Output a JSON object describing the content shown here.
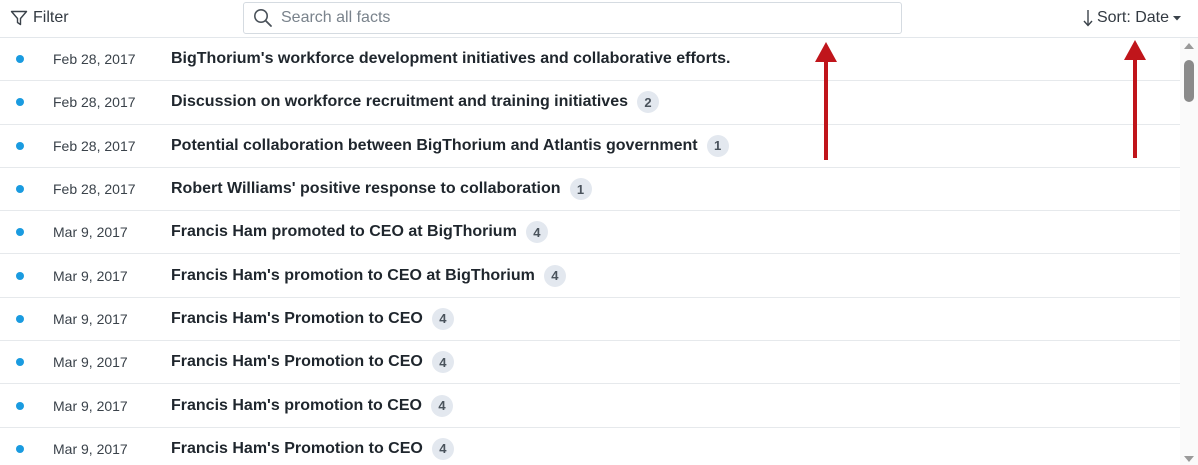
{
  "toolbar": {
    "filter_label": "Filter",
    "search_placeholder": "Search all facts",
    "search_value": "",
    "sort_label": "Sort: Date"
  },
  "icons": {
    "filter": "filter-icon",
    "search": "search-icon",
    "sort": "sort-arrow-down-icon",
    "sort_dropdown": "caret-down-icon"
  },
  "colors": {
    "dot": "#1a9be0",
    "count_badge_bg": "#e3e8ef",
    "annotation_arrow": "#c0151b"
  },
  "facts": [
    {
      "date": "Feb 28, 2017",
      "title": "BigThorium's workforce development initiatives and collaborative efforts.",
      "count": ""
    },
    {
      "date": "Feb 28, 2017",
      "title": "Discussion on workforce recruitment and training initiatives",
      "count": "2"
    },
    {
      "date": "Feb 28, 2017",
      "title": "Potential collaboration between BigThorium and Atlantis government",
      "count": "1"
    },
    {
      "date": "Feb 28, 2017",
      "title": "Robert Williams' positive response to collaboration",
      "count": "1"
    },
    {
      "date": "Mar 9, 2017",
      "title": "Francis Ham promoted to CEO at BigThorium",
      "count": "4"
    },
    {
      "date": "Mar 9, 2017",
      "title": "Francis Ham's promotion to CEO at BigThorium",
      "count": "4"
    },
    {
      "date": "Mar 9, 2017",
      "title": "Francis Ham's Promotion to CEO",
      "count": "4"
    },
    {
      "date": "Mar 9, 2017",
      "title": "Francis Ham's Promotion to CEO",
      "count": "4"
    },
    {
      "date": "Mar 9, 2017",
      "title": "Francis Ham's promotion to CEO",
      "count": "4"
    },
    {
      "date": "Mar 9, 2017",
      "title": "Francis Ham's Promotion to CEO",
      "count": "4"
    }
  ]
}
